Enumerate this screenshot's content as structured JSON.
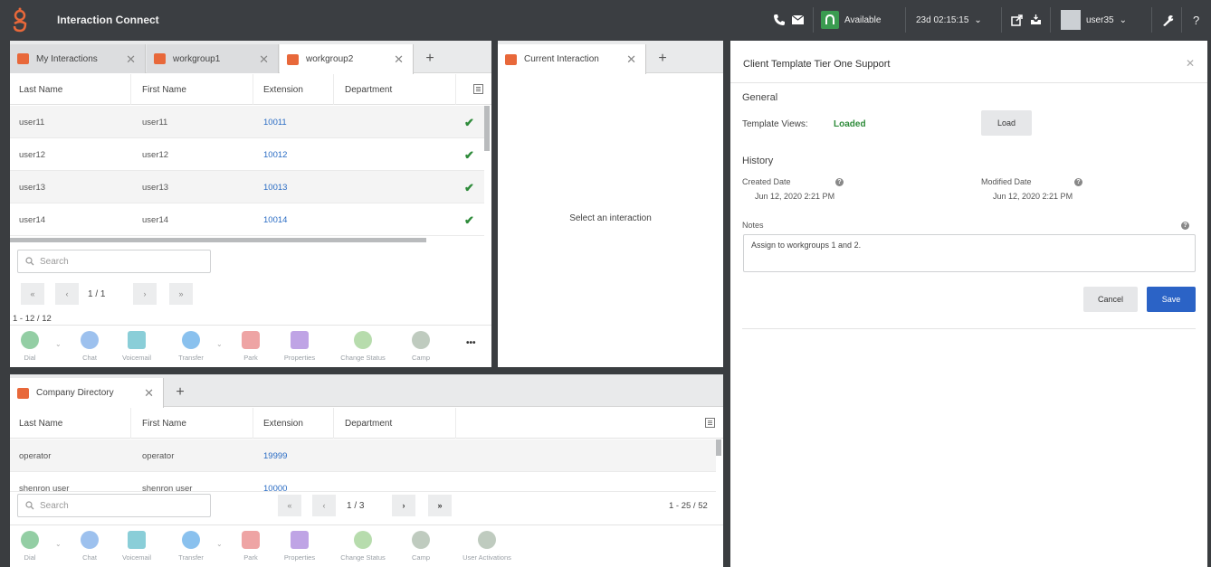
{
  "app": {
    "title": "Interaction Connect",
    "brand_color": "#e8683a"
  },
  "topbar": {
    "status": "Available",
    "timer": "23d 02:15:15",
    "timer_caret": "⌄",
    "user": "user35",
    "user_caret": "⌄",
    "help": "?"
  },
  "interactions_panel": {
    "tabs": [
      {
        "label": "My Interactions",
        "close": "✕"
      },
      {
        "label": "workgroup1",
        "close": "✕"
      },
      {
        "label": "workgroup2",
        "close": "✕"
      }
    ],
    "add_tab": "+",
    "columns": [
      "Last Name",
      "First Name",
      "Extension",
      "Department"
    ],
    "rows": [
      {
        "last": "user11",
        "first": "user11",
        "ext": "10011",
        "check": "✔"
      },
      {
        "last": "user12",
        "first": "user12",
        "ext": "10012",
        "check": "✔"
      },
      {
        "last": "user13",
        "first": "user13",
        "ext": "10013",
        "check": "✔"
      },
      {
        "last": "user14",
        "first": "user14",
        "ext": "10014",
        "check": "✔"
      }
    ],
    "search_placeholder": "Search",
    "pager": {
      "first": "«",
      "prev": "‹",
      "page": "1 / 1",
      "next": "›",
      "last": "»",
      "range": "1 - 12 / 12"
    },
    "tools": [
      "Dial",
      "Chat",
      "Voicemail",
      "Transfer",
      "Park",
      "Properties",
      "Change Status",
      "Camp"
    ],
    "more": "•••"
  },
  "current_panel": {
    "tab": "Current Interaction",
    "close": "✕",
    "add_tab": "+",
    "empty_text": "Select an interaction"
  },
  "directory_panel": {
    "tab": "Company Directory",
    "close": "✕",
    "add_tab": "+",
    "columns": [
      "Last Name",
      "First Name",
      "Extension",
      "Department"
    ],
    "rows": [
      {
        "last": "operator",
        "first": "operator",
        "ext": "19999"
      },
      {
        "last": "shenron user",
        "first": "shenron user",
        "ext": "10000"
      }
    ],
    "search_placeholder": "Search",
    "pager": {
      "first": "«",
      "prev": "‹",
      "page": "1 / 3",
      "next": "›",
      "last": "»",
      "range": "1 - 25 / 52"
    },
    "tools": [
      "Dial",
      "Chat",
      "Voicemail",
      "Transfer",
      "Park",
      "Properties",
      "Change Status",
      "Camp",
      "User Activations"
    ]
  },
  "template_panel": {
    "title": "Client Template Tier One Support",
    "close": "✕",
    "general_heading": "General",
    "template_views_label": "Template Views:",
    "template_views_value": "Loaded",
    "load_button": "Load",
    "history_heading": "History",
    "created_label": "Created Date",
    "created_value": "Jun 12, 2020 2:21 PM",
    "modified_label": "Modified Date",
    "modified_value": "Jun 12, 2020 2:21 PM",
    "notes_label": "Notes",
    "notes_value": "Assign to workgroups 1 and 2.",
    "cancel_button": "Cancel",
    "save_button": "Save"
  }
}
